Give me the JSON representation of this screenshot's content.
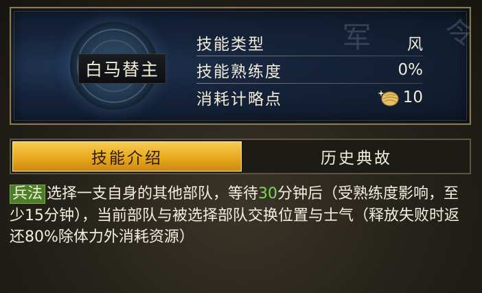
{
  "skill": {
    "name": "白马替主",
    "stats": [
      {
        "label": "技能类型",
        "value": "风"
      },
      {
        "label": "技能熟练度",
        "value": "0%"
      },
      {
        "label": "消耗计略点",
        "value": "10",
        "icon": "strategy-point-icon"
      }
    ]
  },
  "tabs": [
    {
      "label": "技能介绍",
      "active": true
    },
    {
      "label": "历史典故",
      "active": false
    }
  ],
  "description": {
    "tag": "兵法",
    "part1": "选择一支自身的其他部队，等待",
    "wait_minutes": "30",
    "part2": "分钟后（受熟练度影响，至少15分钟），当前部队与被选择部队交换位置与士气（释放失败时返还80%除体力外消耗资源）"
  },
  "colors": {
    "tab_active": "#e8a91c",
    "tag_badge": "#4e7e2c",
    "highlight_number": "#7ed957"
  }
}
